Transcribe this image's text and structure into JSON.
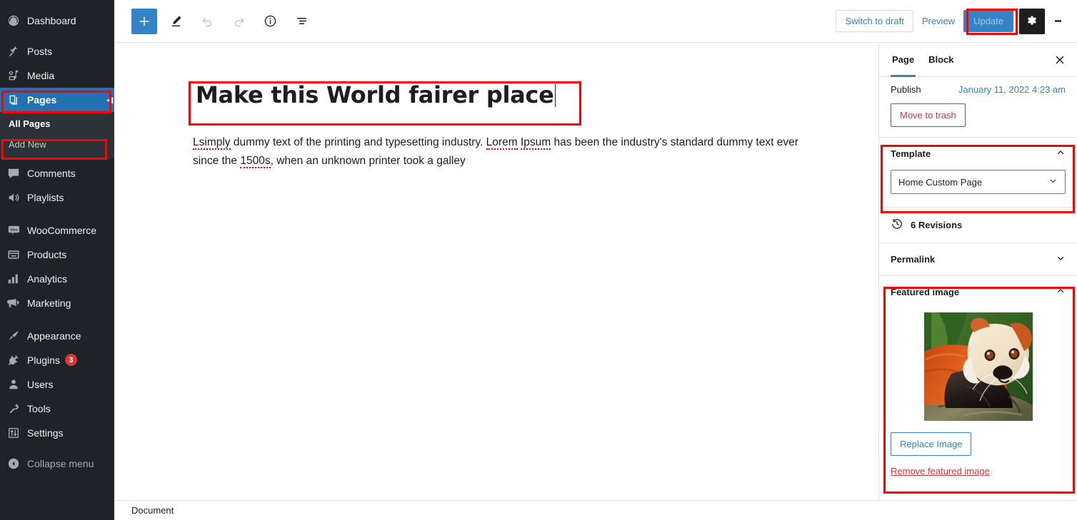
{
  "admin_menu": {
    "items": [
      {
        "label": "Dashboard",
        "icon": "dashboard-icon"
      },
      {
        "label": "Posts",
        "icon": "pin-icon"
      },
      {
        "label": "Media",
        "icon": "media-icon"
      },
      {
        "label": "Pages",
        "icon": "pages-icon",
        "current": true,
        "arrow": "◀"
      },
      {
        "label": "Comments",
        "icon": "comments-icon"
      },
      {
        "label": "Playlists",
        "icon": "playlist-icon"
      },
      {
        "label": "WooCommerce",
        "icon": "woocommerce-icon"
      },
      {
        "label": "Products",
        "icon": "products-icon"
      },
      {
        "label": "Analytics",
        "icon": "analytics-icon"
      },
      {
        "label": "Marketing",
        "icon": "marketing-icon"
      },
      {
        "label": "Appearance",
        "icon": "appearance-icon"
      },
      {
        "label": "Plugins",
        "icon": "plugins-icon",
        "badge": "3"
      },
      {
        "label": "Users",
        "icon": "users-icon"
      },
      {
        "label": "Tools",
        "icon": "tools-icon"
      },
      {
        "label": "Settings",
        "icon": "settings-icon"
      },
      {
        "label": "Collapse menu",
        "icon": "collapse-icon"
      }
    ],
    "submenu": {
      "all_pages": "All Pages",
      "add_new": "Add New"
    }
  },
  "toolbar": {
    "add_block_label": "+",
    "tools_icon": "pencil-icon",
    "undo_icon": "undo-icon",
    "redo_icon": "redo-icon",
    "details_icon": "info-icon",
    "list_view_icon": "list-view-icon",
    "switch_to_draft": "Switch to draft",
    "preview": "Preview",
    "update": "Update",
    "settings_icon": "gear-icon",
    "more_icon": "kebab-menu-icon"
  },
  "editor": {
    "title": "Make this World fairer place",
    "paragraph_parts": [
      {
        "text": "Lsimply",
        "misspelled": true
      },
      {
        "text": " dummy text of the printing and typesetting industry. ",
        "misspelled": false
      },
      {
        "text": "Lorem",
        "misspelled": true
      },
      {
        "text": " ",
        "misspelled": false
      },
      {
        "text": "Ipsum",
        "misspelled": true
      },
      {
        "text": " has been the industry's standard dummy text ever since the ",
        "misspelled": false
      },
      {
        "text": "1500s",
        "misspelled": true
      },
      {
        "text": ", when an unknown printer took a galley",
        "misspelled": false
      }
    ],
    "status_bar": "Document"
  },
  "settings_panel": {
    "tabs": [
      {
        "label": "Page",
        "active": true
      },
      {
        "label": "Block",
        "active": false
      }
    ],
    "close_icon": "close-icon",
    "publish": {
      "label": "Publish",
      "value": "January 11, 2022 4:23 am"
    },
    "move_to_trash": "Move to trash",
    "template": {
      "title": "Template",
      "selected": "Home Custom Page",
      "chevron": "collapse-chevron-up"
    },
    "revisions": {
      "label": "6 Revisions",
      "icon": "revisions-clock-icon"
    },
    "permalink": {
      "title": "Permalink",
      "chevron": "expand-chevron-down"
    },
    "featured_image": {
      "title": "Featured image",
      "chevron": "collapse-chevron-up",
      "alt": "red-panda-photo",
      "replace_label": "Replace Image",
      "remove_label": "Remove featured image"
    }
  },
  "colors": {
    "sidebar_bg": "#1d2327",
    "submenu_bg": "#2c3338",
    "current_blue": "#2271b1",
    "accent_blue": "#3582c4",
    "danger_red": "#d63638",
    "highlight_red": "#ff0000"
  }
}
